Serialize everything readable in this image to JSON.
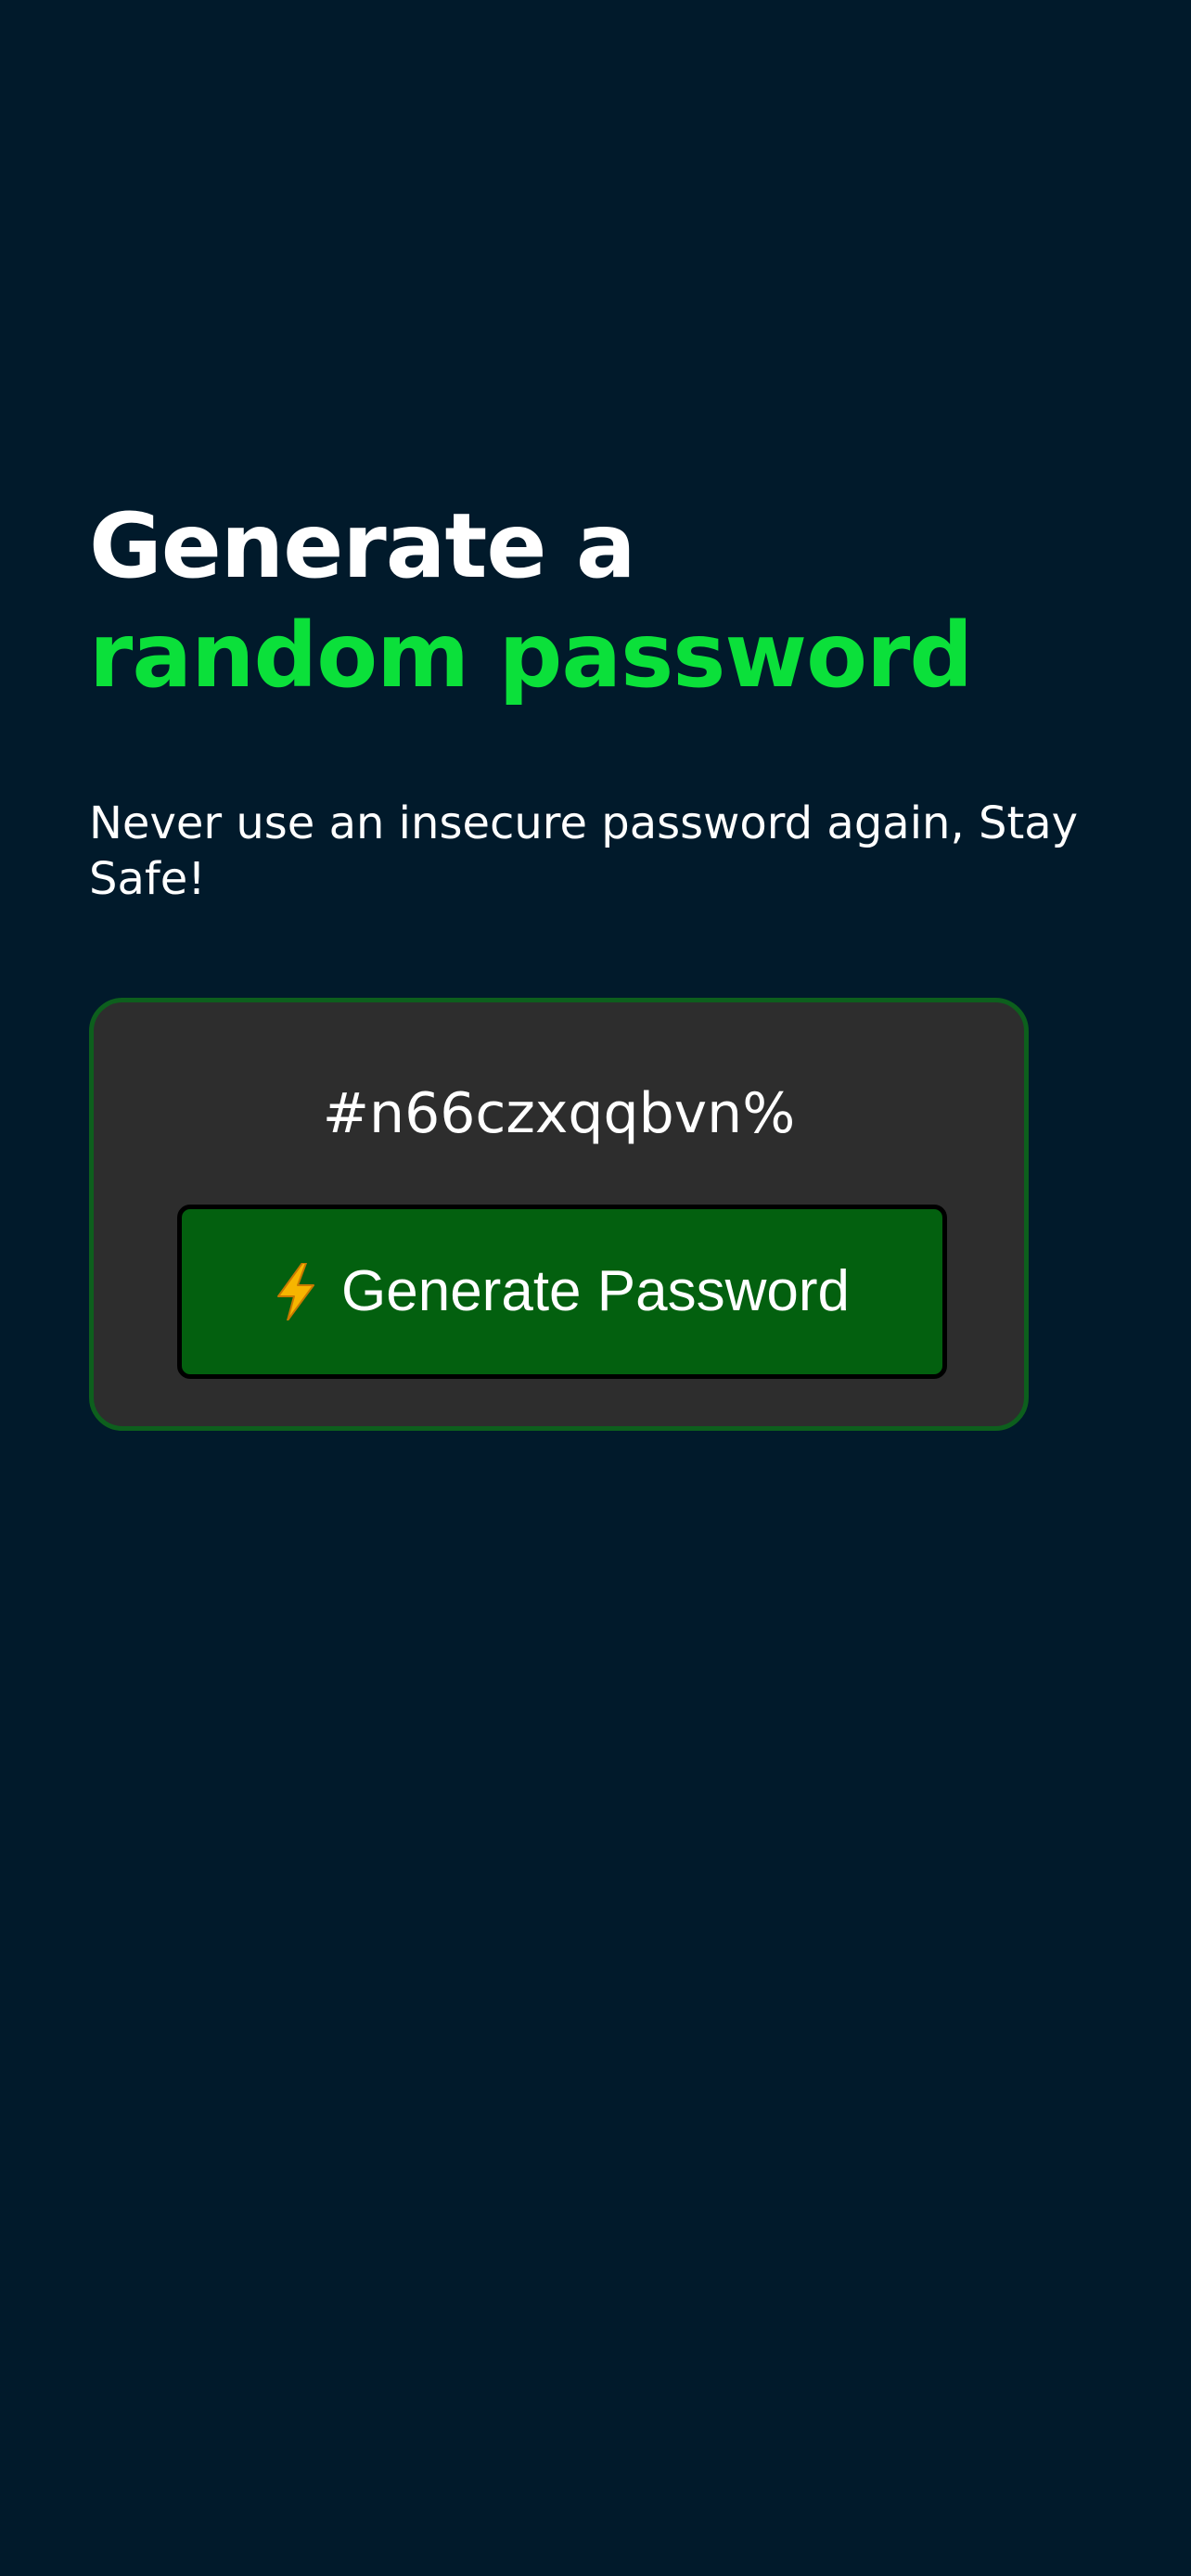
{
  "hero": {
    "title_line1": "Generate a",
    "title_line2": "random password",
    "subtitle": "Never use an insecure password again, Stay Safe!"
  },
  "card": {
    "password": "#n66czxqqbvn%",
    "button": {
      "icon": "lightning-bolt-icon",
      "label": "Generate Password"
    }
  },
  "colors": {
    "background": "#011a2b",
    "accent": "#0be03a",
    "card_background": "#2d2d2d",
    "card_border": "#0d5f1d",
    "button_background": "#03600f"
  }
}
